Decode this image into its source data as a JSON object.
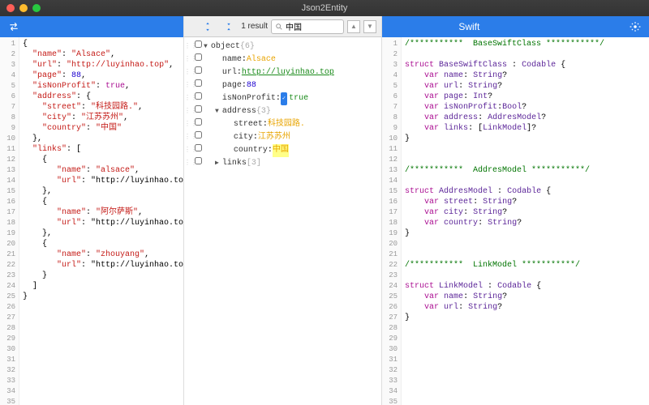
{
  "window": {
    "title": "Json2Entity"
  },
  "search": {
    "result": "1 result",
    "query": "中国"
  },
  "right_label": "Swift",
  "json_lines": [
    "{",
    "  \"name\": \"Alsace\",",
    "  \"url\": \"http://luyinhao.top\",",
    "  \"page\": 88,",
    "  \"isNonProfit\": true,",
    "  \"address\": {",
    "    \"street\": \"科技园路.\",",
    "    \"city\": \"江苏苏州\",",
    "    \"country\": \"中国\"",
    "  },",
    "  \"links\": [",
    "    {",
    "       \"name\": \"alsace\",",
    "       \"url\": \"http://luyinhao.to",
    "    },",
    "    {",
    "       \"name\": \"阿尔萨斯\",",
    "       \"url\": \"http://luyinhao.to",
    "    },",
    "    {",
    "       \"name\": \"zhouyang\",",
    "       \"url\": \"http://luyinhao.to",
    "    }",
    "  ]",
    "}"
  ],
  "tree": [
    {
      "indent": 0,
      "disc": "▼",
      "key": "object",
      "count": "{6}"
    },
    {
      "indent": 1,
      "key": "name",
      "sep": " : ",
      "val": "Alsace",
      "cls": "tval"
    },
    {
      "indent": 1,
      "key": "url",
      "sep": "  : ",
      "val": "http://luyinhao.top",
      "cls": "turl"
    },
    {
      "indent": 1,
      "key": "page",
      "sep": " : ",
      "val": "88",
      "cls": "tnum"
    },
    {
      "indent": 1,
      "key": "isNonProfit",
      "sep": " : ",
      "bool": true,
      "val": "true",
      "cls": "tbool"
    },
    {
      "indent": 1,
      "disc": "▼",
      "key": "address",
      "count": "{3}"
    },
    {
      "indent": 2,
      "key": "street",
      "sep": " : ",
      "val": "科技园路.",
      "cls": "tval"
    },
    {
      "indent": 2,
      "key": "city",
      "sep": " : ",
      "val": "江苏苏州",
      "cls": "tval"
    },
    {
      "indent": 2,
      "key": "country",
      "sep": " : ",
      "val": "中国",
      "cls": "tval",
      "hl": true
    },
    {
      "indent": 1,
      "disc": "▶",
      "key": "links",
      "count": "[3]"
    }
  ],
  "swift": {
    "c1": "/***********  BaseSwiftClass ***********/",
    "s1": "struct BaseSwiftClass : Codable {",
    "v1": "    var name: String?",
    "v2": "    var url: String?",
    "v3": "    var page: Int?",
    "v4": "    var isNonProfit:Bool?",
    "v5": "    var address: AddresModel?",
    "v6": "    var links: [LinkModel]?",
    "e": "}",
    "c2": "/***********  AddresModel ***********/",
    "s2": "struct AddresModel : Codable {",
    "v7": "    var street: String?",
    "v8": "    var city: String?",
    "v9": "    var country: String?",
    "c3": "/***********  LinkModel ***********/",
    "s3": "struct LinkModel : Codable {",
    "v10": "    var name: String?",
    "v11": "    var url: String?"
  }
}
